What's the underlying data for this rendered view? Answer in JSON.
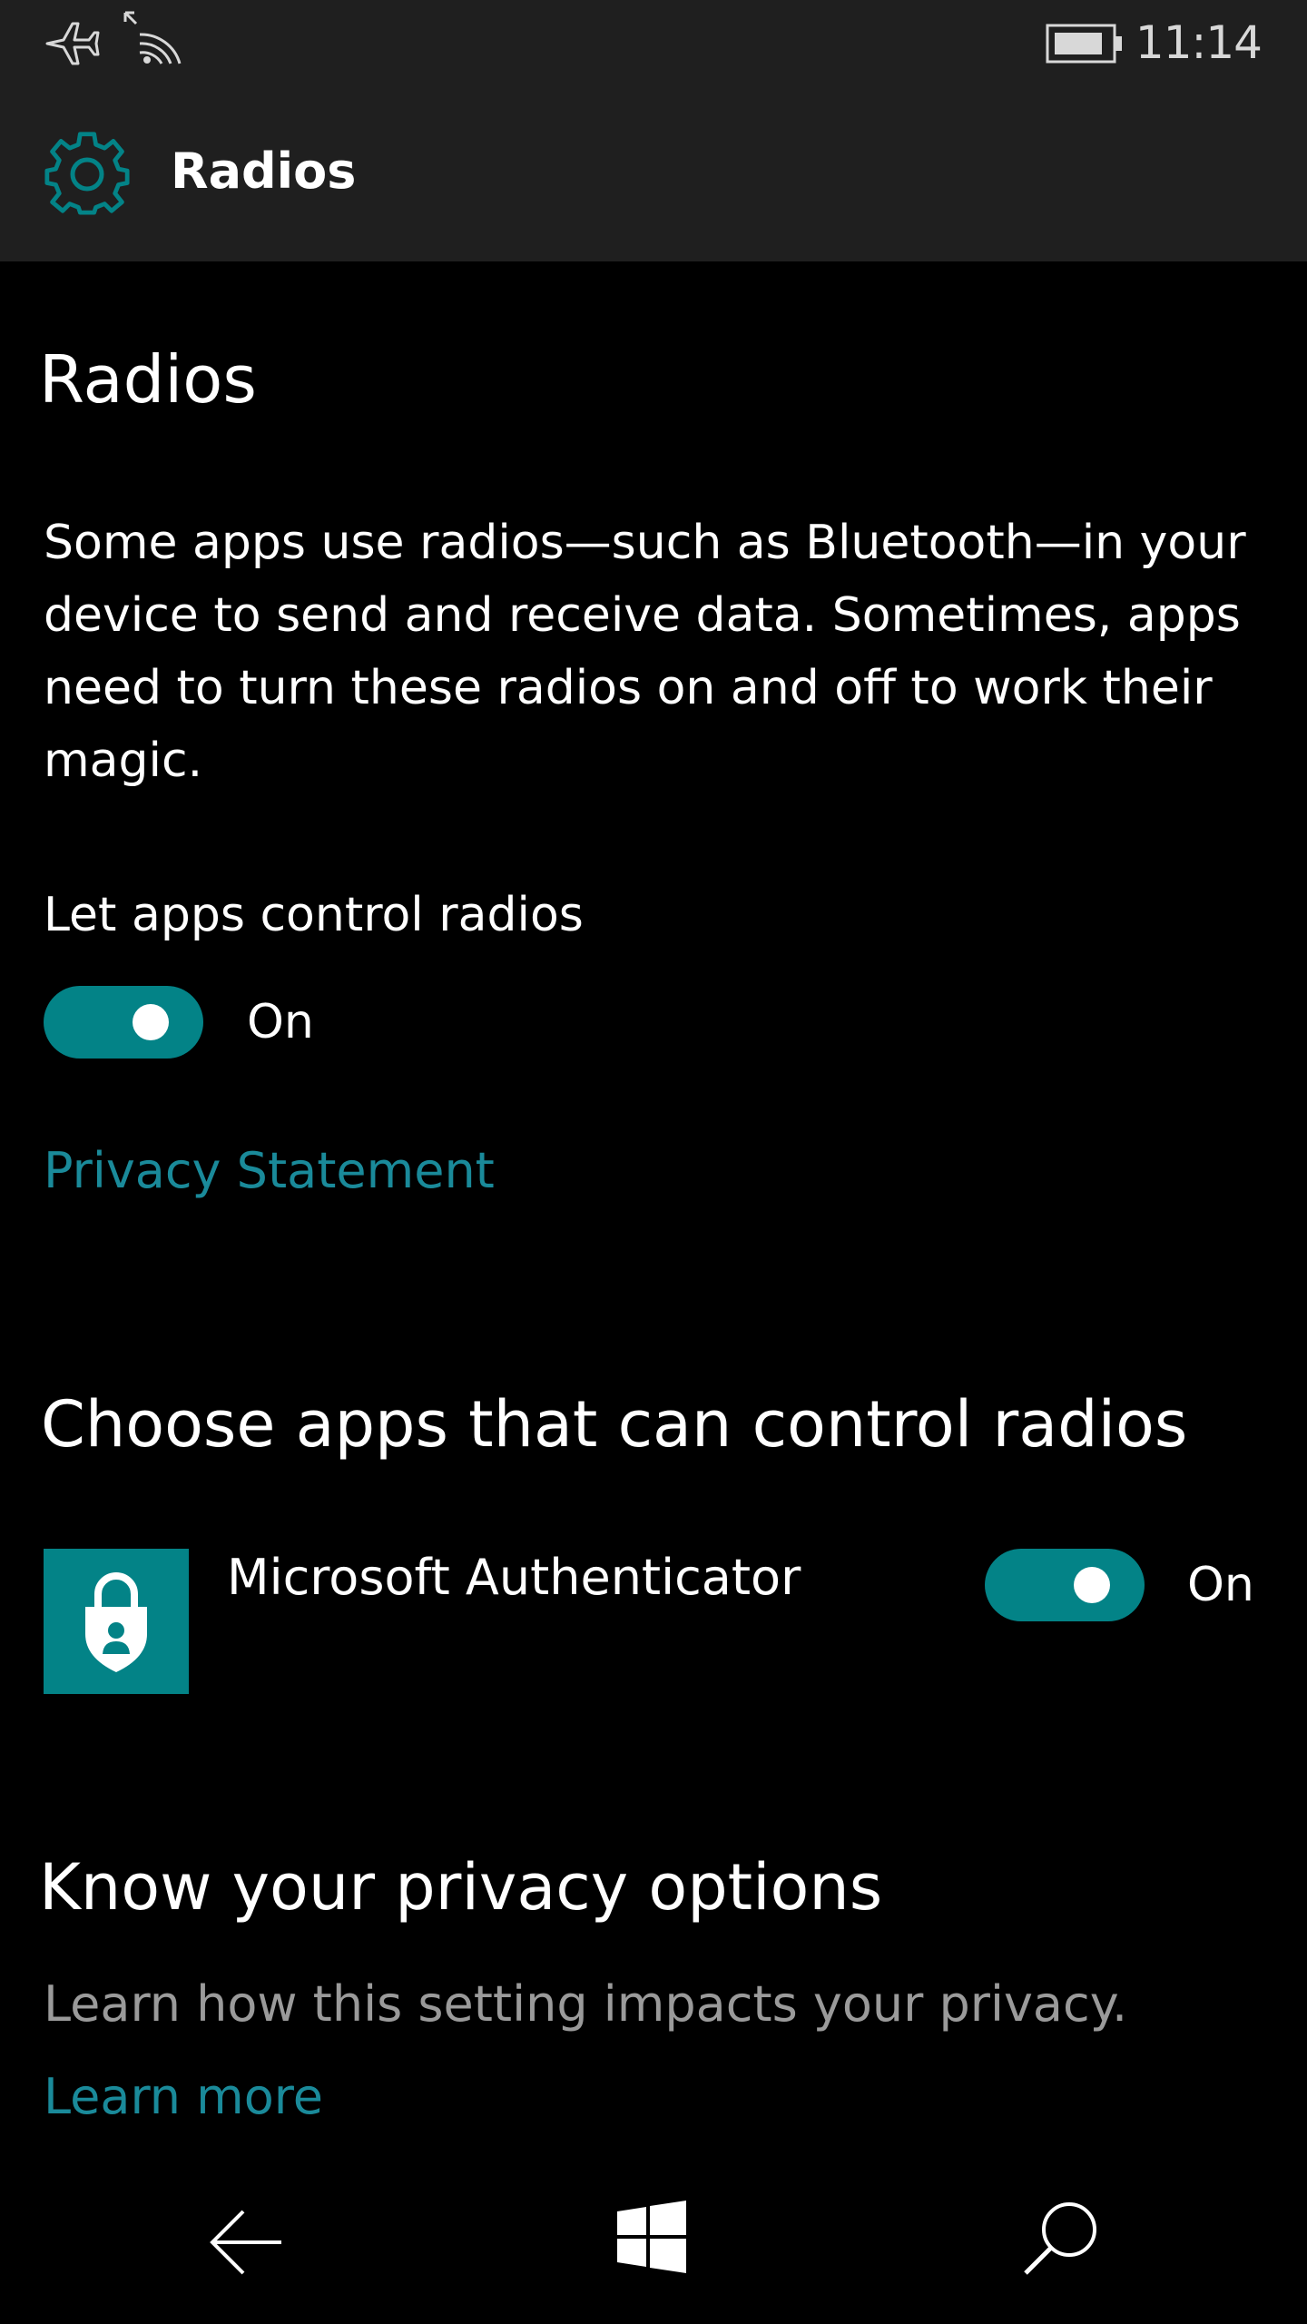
{
  "status_bar": {
    "time": "11:14",
    "icons": [
      "airplane-mode-icon",
      "wifi-icon",
      "battery-icon"
    ]
  },
  "header": {
    "title": "Radios",
    "icon": "gear-icon",
    "accent": "#038387"
  },
  "main": {
    "heading": "Radios",
    "description": "Some apps use radios—such as Bluetooth—in your device to send and receive data. Sometimes, apps need to turn these radios on and off to work their magic.",
    "control_label": "Let apps control radios",
    "control_toggle_state": "On",
    "privacy_link": "Privacy Statement",
    "apps_heading": "Choose apps that can control radios",
    "apps": [
      {
        "name": "Microsoft Authenticator",
        "icon": "authenticator-lock-icon",
        "toggle_state": "On"
      }
    ],
    "privacy_heading": "Know your privacy options",
    "privacy_text": "Learn how this setting impacts your privacy.",
    "learn_more_link": "Learn more"
  },
  "nav_bar": {
    "buttons": [
      "back-icon",
      "windows-start-icon",
      "search-icon"
    ]
  },
  "colors": {
    "background": "#000000",
    "bar": "#1f1f1f",
    "accent": "#038387",
    "link": "#1a8a9a",
    "muted_text": "#9a9a9a"
  }
}
